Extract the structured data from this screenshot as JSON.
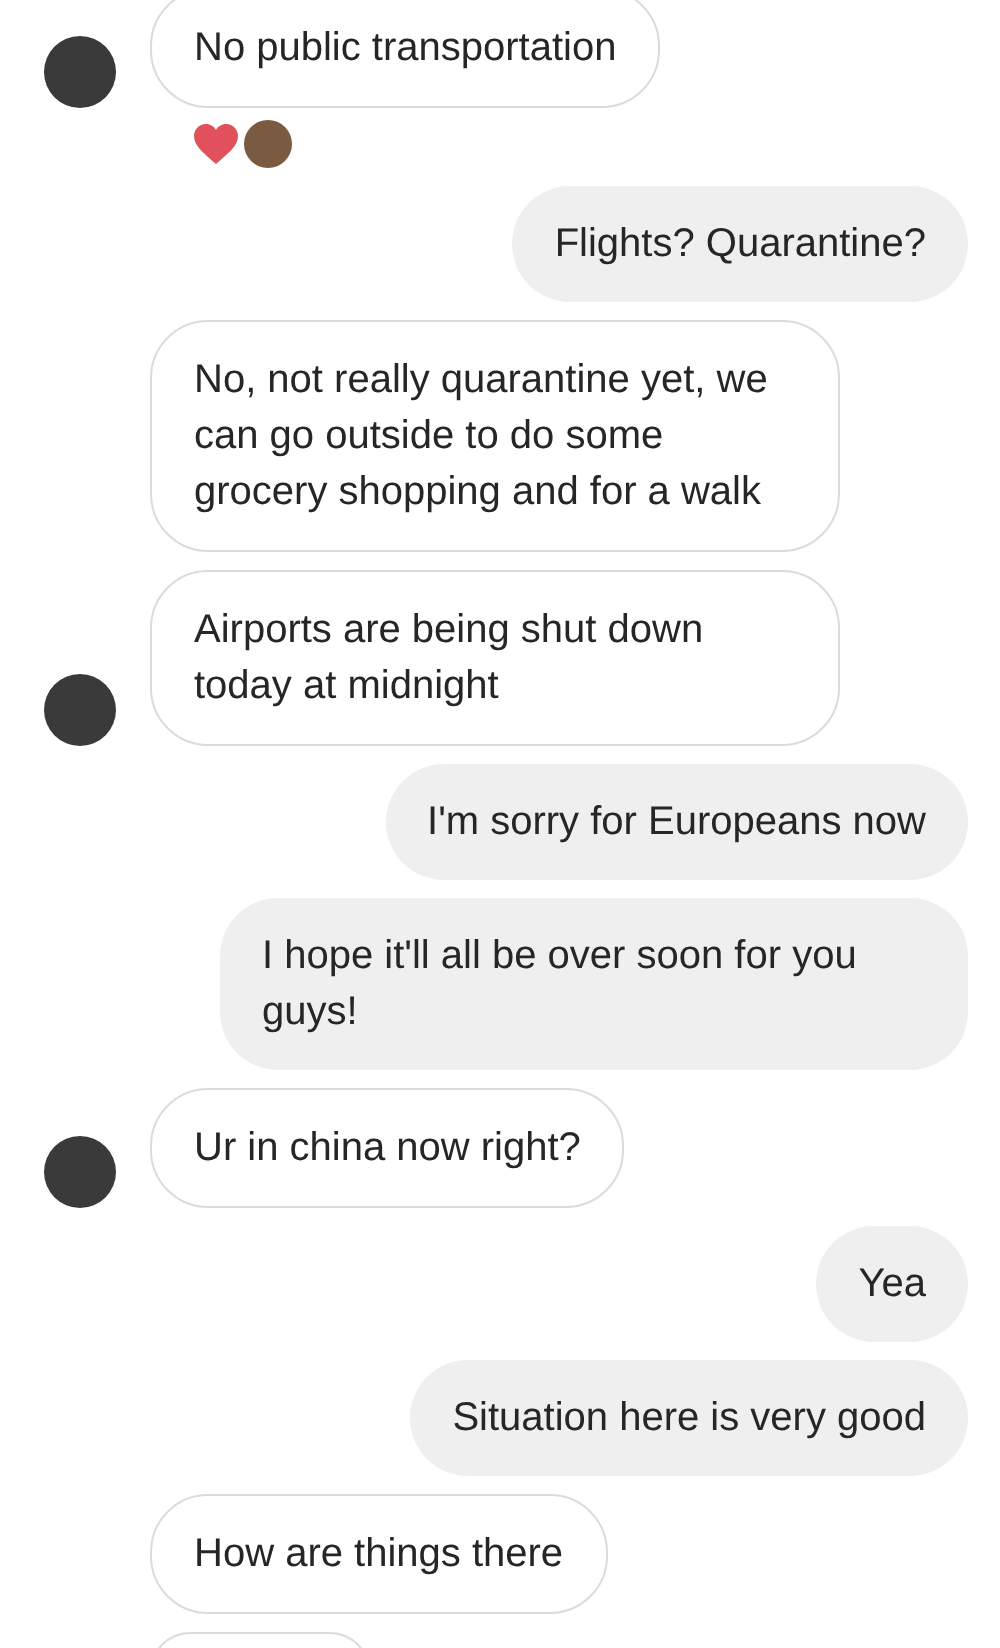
{
  "messages": [
    {
      "kind": "received",
      "text": "No public transportation",
      "avatar": true,
      "reacted": true
    },
    {
      "kind": "sent",
      "text": "Flights? Quarantine?"
    },
    {
      "kind": "received",
      "text": "No, not really quarantine yet, we can go outside to do some grocery shopping and for a walk",
      "avatar": false
    },
    {
      "kind": "received",
      "text": "Airports are being shut down today at midnight",
      "avatar": true
    },
    {
      "kind": "sent",
      "text": "I'm sorry for Europeans now"
    },
    {
      "kind": "sent",
      "text": "I hope it'll all be over soon for you guys!"
    },
    {
      "kind": "received",
      "text": "Ur in china now right?",
      "avatar": true
    },
    {
      "kind": "sent",
      "text": "Yea"
    },
    {
      "kind": "sent",
      "text": "Situation here is very good"
    },
    {
      "kind": "received",
      "text": "How are things there",
      "avatar": false
    }
  ]
}
